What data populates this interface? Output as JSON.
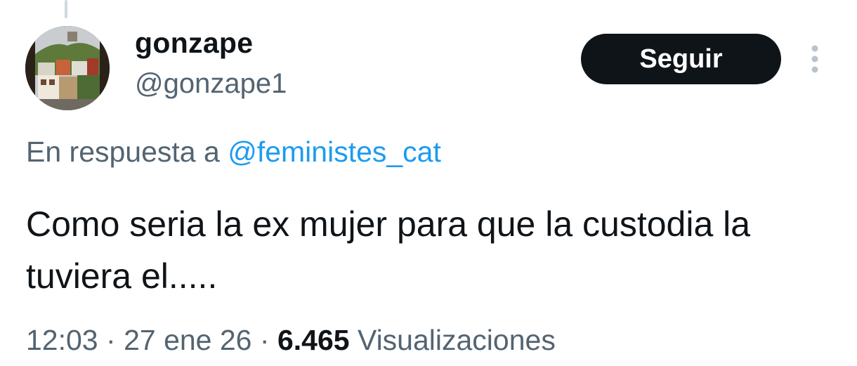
{
  "tweet": {
    "author": {
      "display_name": "gonzape",
      "handle": "@gonzape1"
    },
    "follow_label": "Seguir",
    "more_icon": "more-vertical-icon",
    "reply": {
      "prefix": "En respuesta a",
      "to_handle": "@feministes_cat"
    },
    "text": "Como seria la ex mujer para que la custodia la tuviera el.....",
    "meta": {
      "time": "12:03",
      "separator": "·",
      "date": "27 ene 26",
      "views_count": "6.465",
      "views_label": "Visualizaciones"
    },
    "colors": {
      "text_primary": "#0f1419",
      "text_secondary": "#536471",
      "link": "#1d9bf0",
      "button_bg": "#0f1419",
      "button_text": "#ffffff",
      "thread_line": "#cfd9de"
    }
  }
}
